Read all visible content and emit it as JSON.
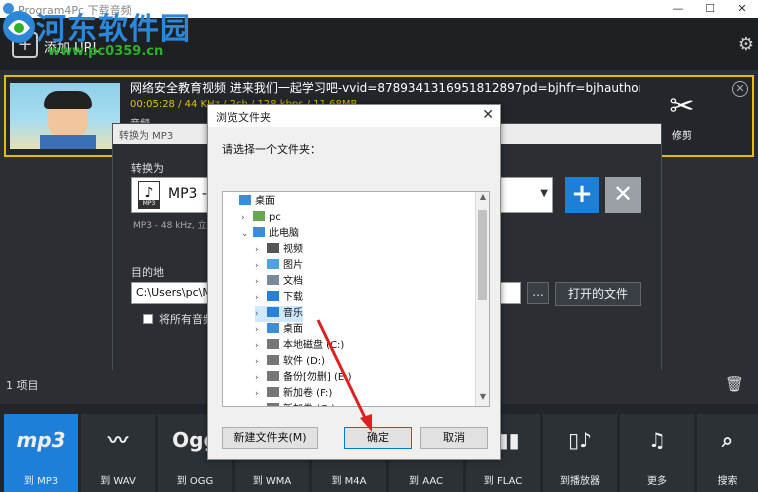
{
  "window": {
    "title": "Program4Pc 下载音频"
  },
  "watermark": {
    "site_name": "河东软件园",
    "url": "www.pc0359.cn"
  },
  "toolbar": {
    "add_url_label": "添加 URL"
  },
  "file_item": {
    "title": "网络安全教育视频 进来我们一起学习吧-vvid=8789341316951812897pd=bjhfr=bjhauthortype=vi...",
    "meta": "00:05:28  /  44 KHz  /  2ch  /  128 kbps  /  11.68MB",
    "subtitle": "音频",
    "cut_label": "修剪"
  },
  "convert_panel": {
    "header": "转换为 MP3",
    "convert_to_label": "转换为",
    "format_name": "MP3 - ",
    "format_icon_label": "MP3",
    "format_sub": "MP3 - 48 kHz, 立",
    "destination_label": "目的地",
    "destination_path": "C:\\Users\\pc\\M",
    "browse_label": "...",
    "open_folder_label": "打开的文件",
    "merge_checkbox_label": "将所有音频"
  },
  "list_info": {
    "count": "1 项目"
  },
  "format_buttons": [
    {
      "label": "到 MP3",
      "icon": "mp3"
    },
    {
      "label": "到 WAV",
      "icon": "wave"
    },
    {
      "label": "到 OGG",
      "icon": "Ogg"
    },
    {
      "label": "到 WMA",
      "icon": "WMA"
    },
    {
      "label": "到 M4A",
      "icon": "M4A"
    },
    {
      "label": "到 AAC",
      "icon": "AAC"
    },
    {
      "label": "到 FLAC",
      "icon": "FLAC"
    },
    {
      "label": "到播放器",
      "icon": "player"
    },
    {
      "label": "更多",
      "icon": "notes"
    },
    {
      "label": "搜索",
      "icon": "search"
    }
  ],
  "dialog": {
    "title": "浏览文件夹",
    "prompt": "请选择一个文件夹：",
    "tree": [
      {
        "label": "桌面",
        "level": 0,
        "expander": "",
        "icon": "desktop"
      },
      {
        "label": "pc",
        "level": 1,
        "expander": "›",
        "icon": "user"
      },
      {
        "label": "此电脑",
        "level": 1,
        "expander": "⌄",
        "icon": "computer"
      },
      {
        "label": "视频",
        "level": 2,
        "expander": "›",
        "icon": "video"
      },
      {
        "label": "图片",
        "level": 2,
        "expander": "›",
        "icon": "picture"
      },
      {
        "label": "文档",
        "level": 2,
        "expander": "›",
        "icon": "document"
      },
      {
        "label": "下载",
        "level": 2,
        "expander": "›",
        "icon": "download"
      },
      {
        "label": "音乐",
        "level": 2,
        "expander": "›",
        "icon": "music",
        "selected": true
      },
      {
        "label": "桌面",
        "level": 2,
        "expander": "›",
        "icon": "desktop"
      },
      {
        "label": "本地磁盘 (C:)",
        "level": 2,
        "expander": "›",
        "icon": "disk"
      },
      {
        "label": "软件 (D:)",
        "level": 2,
        "expander": "›",
        "icon": "disk"
      },
      {
        "label": "备份[勿删] (E:)",
        "level": 2,
        "expander": "›",
        "icon": "disk"
      },
      {
        "label": "新加卷 (F:)",
        "level": 2,
        "expander": "›",
        "icon": "disk"
      },
      {
        "label": "新加卷 (G:)",
        "level": 2,
        "expander": "›",
        "icon": "disk"
      }
    ],
    "new_folder_label": "新建文件夹(M)",
    "ok_label": "确定",
    "cancel_label": "取消"
  },
  "colors": {
    "accent": "#1e7fd8",
    "highlight": "#e0c200",
    "annotation_arrow": "#e02020"
  }
}
